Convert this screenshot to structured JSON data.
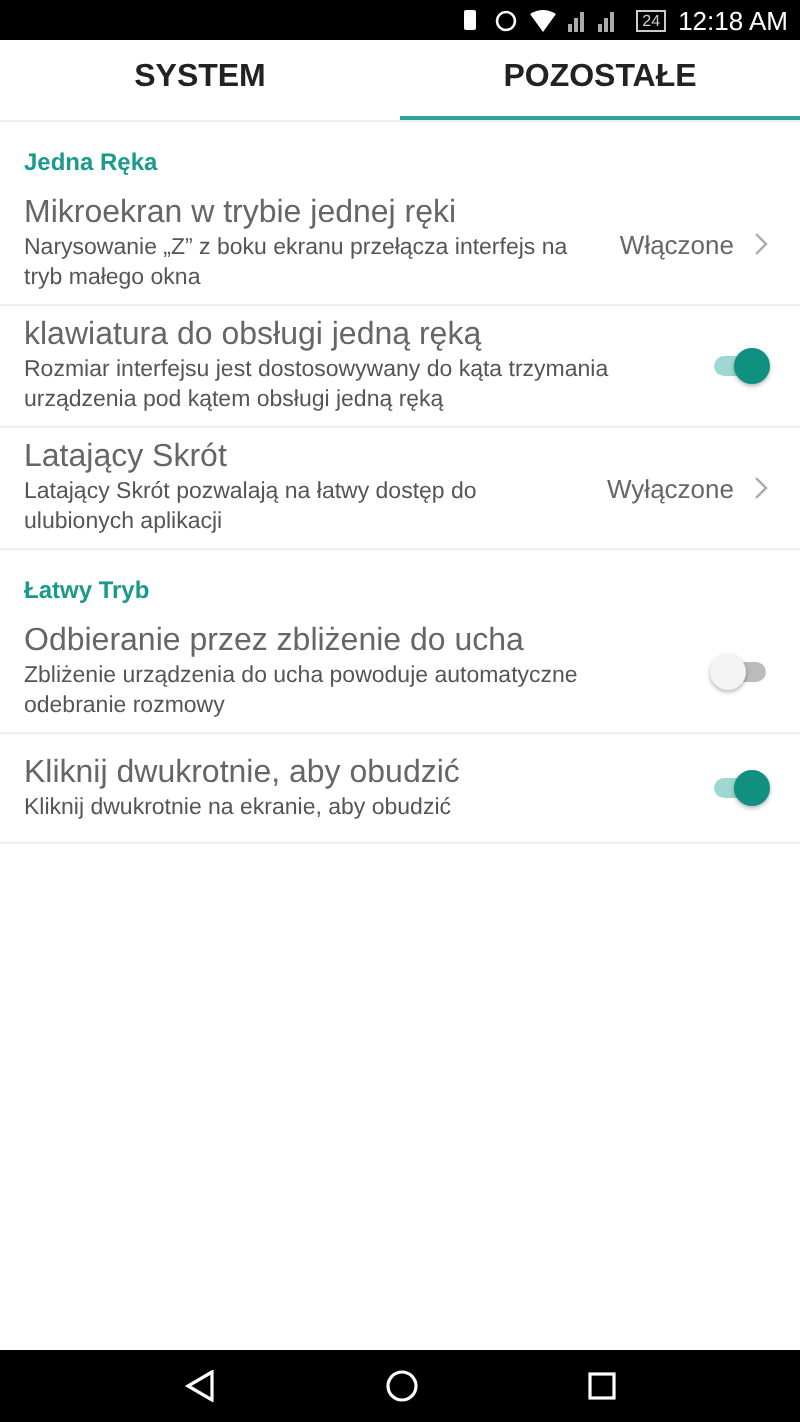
{
  "status_bar": {
    "time": "12:18 AM",
    "battery": "24"
  },
  "tabs": [
    {
      "label": "SYSTEM",
      "selected": false
    },
    {
      "label": "POZOSTAŁE",
      "selected": true
    }
  ],
  "sections": [
    {
      "title": "Jedna Ręka",
      "items": [
        {
          "kind": "value",
          "title": "Mikroekran w trybie jednej ręki",
          "subtitle": "Narysowanie „Z” z boku ekranu przełącza interfejs na tryb małego okna",
          "value": "Włączone"
        },
        {
          "kind": "switch",
          "title": "klawiatura do obsługi jedną ręką",
          "subtitle": "Rozmiar interfejsu jest dostosowywany do kąta trzymania urządzenia pod kątem obsługi jedną ręką",
          "on": true
        },
        {
          "kind": "value",
          "title": "Latający Skrót",
          "subtitle": "Latający Skrót pozwalają na łatwy dostęp do ulubionych aplikacji",
          "value": "Wyłączone"
        }
      ]
    },
    {
      "title": "Łatwy Tryb",
      "items": [
        {
          "kind": "switch",
          "title": "Odbieranie przez zbliżenie do ucha",
          "subtitle": "Zbliżenie urządzenia do ucha powoduje automatyczne odebranie rozmowy",
          "on": false
        },
        {
          "kind": "switch",
          "title": "Kliknij dwukrotnie, aby obudzić",
          "subtitle": "Kliknij dwukrotnie na ekranie, aby obudzić",
          "on": true
        }
      ]
    }
  ]
}
